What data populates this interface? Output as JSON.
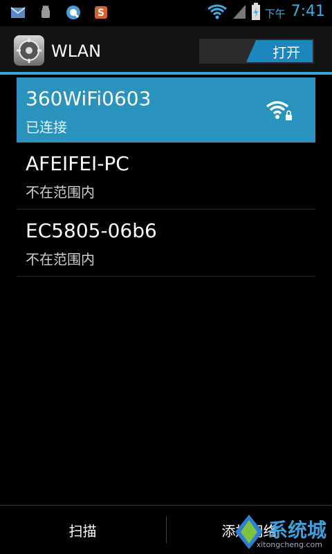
{
  "statusbar": {
    "left_icons": [
      "mail-icon",
      "android-debug-icon",
      "q-app-icon",
      "s-app-icon"
    ],
    "ampm": "下午",
    "time": "7:41",
    "right_icons": [
      "wifi-icon",
      "signal-icon",
      "battery-charging-icon"
    ],
    "accent": "#3ab0e8"
  },
  "titlebar": {
    "icon": "settings-gear-icon",
    "title": "WLAN",
    "toggle_label": "打开",
    "accent": "#33a6d6"
  },
  "networks": [
    {
      "ssid": "360WiFi0603",
      "status": "已连接",
      "active": true,
      "icon": "wifi-lock-icon"
    },
    {
      "ssid": "AFEIFEI-PC",
      "status": "不在范围内",
      "active": false
    },
    {
      "ssid": "EC5805-06b6",
      "status": "不在范围内",
      "active": false
    }
  ],
  "bottombar": {
    "scan_label": "扫描",
    "add_label": "添加网络"
  },
  "watermark": {
    "text": "系统城",
    "url": "xitongcheng.com"
  }
}
